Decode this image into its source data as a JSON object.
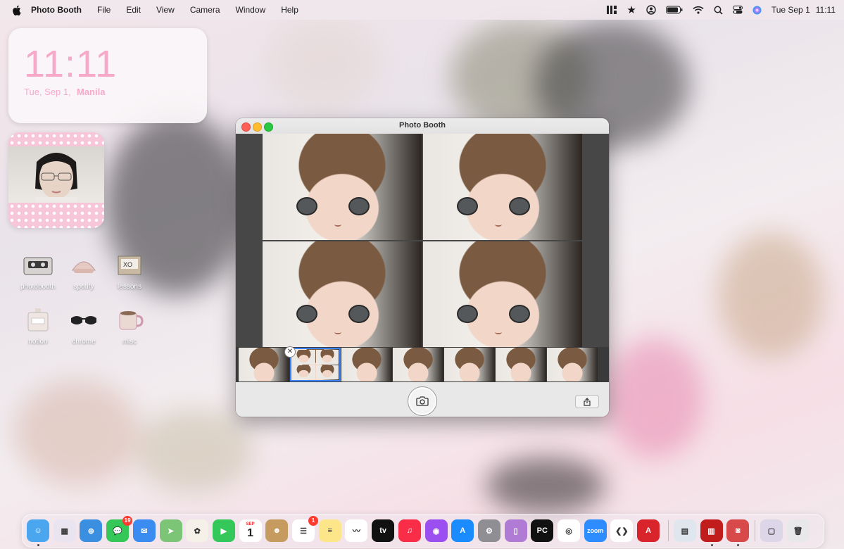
{
  "menubar": {
    "app_name": "Photo Booth",
    "items": [
      "File",
      "Edit",
      "View",
      "Camera",
      "Window",
      "Help"
    ],
    "date": "Tue Sep 1",
    "time": "11:11",
    "status_icons": [
      "widget-icon",
      "star-icon",
      "user-icon",
      "battery-icon",
      "wifi-icon",
      "search-icon",
      "control-center-icon",
      "siri-icon"
    ]
  },
  "clock_widget": {
    "time": "11:11",
    "date": "Tue, Sep 1,",
    "city": "Manila"
  },
  "desktop_icons": [
    {
      "label": "photobooth",
      "color": "#d7d3d0"
    },
    {
      "label": "spotify",
      "color": "#e6c9c3"
    },
    {
      "label": "lessons",
      "color": "#c9b9a3"
    },
    {
      "label": "notion",
      "color": "#efe6e2"
    },
    {
      "label": "chrome",
      "color": "#d3c9c4"
    },
    {
      "label": "misc",
      "color": "#ead8d2"
    }
  ],
  "window": {
    "title": "Photo Booth",
    "thumbnails": 7,
    "selected_thumbnail": 2,
    "shutter_icon": "camera-icon",
    "share_icon": "share-icon",
    "delete_icon": "close-icon"
  },
  "dock": {
    "apps": [
      {
        "name": "finder",
        "color": "#4aa6ef",
        "glyph": "☺",
        "running": true
      },
      {
        "name": "launchpad",
        "color": "#e9e4ef",
        "glyph": "▦"
      },
      {
        "name": "safari",
        "color": "#3b8fe0",
        "glyph": "⊕"
      },
      {
        "name": "messages",
        "color": "#36c759",
        "glyph": "💬",
        "badge": "19"
      },
      {
        "name": "mail",
        "color": "#3a8cf0",
        "glyph": "✉"
      },
      {
        "name": "maps",
        "color": "#7cc576",
        "glyph": "➤"
      },
      {
        "name": "photos",
        "color": "#f5f0e8",
        "glyph": "✿"
      },
      {
        "name": "facetime",
        "color": "#34c759",
        "glyph": "▶"
      },
      {
        "name": "calendar",
        "color": "#ffffff",
        "glyph": "1",
        "sub": "SEP"
      },
      {
        "name": "contacts",
        "color": "#c59b5f",
        "glyph": "☻"
      },
      {
        "name": "reminders",
        "color": "#ffffff",
        "glyph": "☰",
        "badge": "1"
      },
      {
        "name": "notes",
        "color": "#fde68a",
        "glyph": "≡"
      },
      {
        "name": "freeform",
        "color": "#ffffff",
        "glyph": "〰"
      },
      {
        "name": "apple-tv",
        "color": "#111111",
        "glyph": "tv"
      },
      {
        "name": "music",
        "color": "#fa2d48",
        "glyph": "♫"
      },
      {
        "name": "podcasts",
        "color": "#9b4ff0",
        "glyph": "◉"
      },
      {
        "name": "app-store",
        "color": "#1a8cff",
        "glyph": "A"
      },
      {
        "name": "system-settings",
        "color": "#8e8e93",
        "glyph": "⚙"
      },
      {
        "name": "iphone-mirroring",
        "color": "#b07bd4",
        "glyph": "▯"
      },
      {
        "name": "pycharm",
        "color": "#111111",
        "glyph": "PC"
      },
      {
        "name": "chrome",
        "color": "#ffffff",
        "glyph": "◎"
      },
      {
        "name": "zoom",
        "color": "#2d8cff",
        "glyph": "zoom"
      },
      {
        "name": "vscode",
        "color": "#ffffff",
        "glyph": "❮❯"
      },
      {
        "name": "autocad",
        "color": "#d9242b",
        "glyph": "A"
      }
    ],
    "right_apps": [
      {
        "name": "preview",
        "color": "#dfe6ee",
        "glyph": "▤"
      },
      {
        "name": "photo-booth",
        "color": "#c21d1d",
        "glyph": "▥",
        "running": true
      },
      {
        "name": "photo-booth-2",
        "color": "#d84a4a",
        "glyph": "◙",
        "running": true
      }
    ],
    "stack": {
      "name": "downloads",
      "color": "#dcd6e8",
      "glyph": "▢"
    },
    "trash": {
      "name": "trash",
      "color": "#e8e8ea",
      "glyph": "🗑"
    }
  }
}
